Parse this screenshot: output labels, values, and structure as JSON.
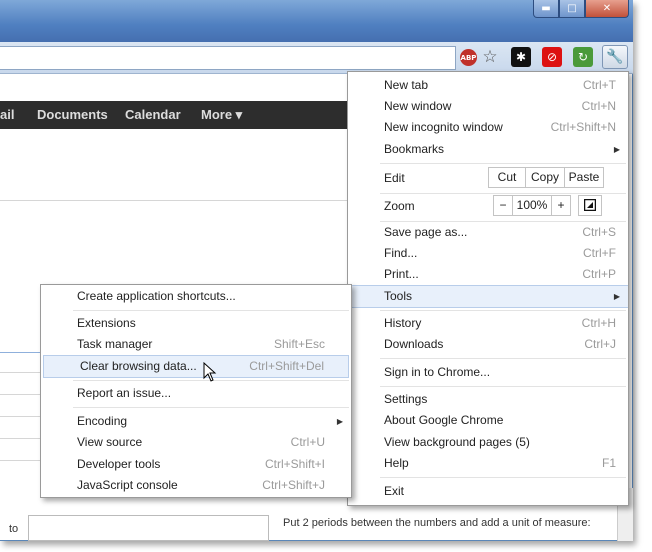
{
  "window": {
    "minimize_label": "▬",
    "maximize_label": "□",
    "close_label": "✕"
  },
  "toolbar": {
    "abp_label": "ABP"
  },
  "gbar": {
    "items": [
      "ail",
      "Documents",
      "Calendar",
      "More ▾"
    ]
  },
  "page": {
    "to_label": "to",
    "hint_line": "Put 2 periods between the numbers and add a unit of measure:"
  },
  "main_menu": {
    "new_tab": {
      "label": "New tab",
      "shortcut": "Ctrl+T"
    },
    "new_window": {
      "label": "New window",
      "shortcut": "Ctrl+N"
    },
    "new_incognito": {
      "label": "New incognito window",
      "shortcut": "Ctrl+Shift+N"
    },
    "bookmarks": {
      "label": "Bookmarks"
    },
    "edit": {
      "label": "Edit",
      "cut": "Cut",
      "copy": "Copy",
      "paste": "Paste"
    },
    "zoom": {
      "label": "Zoom",
      "minus": "−",
      "value": "100%",
      "plus": "+"
    },
    "save_page": {
      "label": "Save page as...",
      "shortcut": "Ctrl+S"
    },
    "find": {
      "label": "Find...",
      "shortcut": "Ctrl+F"
    },
    "print": {
      "label": "Print...",
      "shortcut": "Ctrl+P"
    },
    "tools": {
      "label": "Tools"
    },
    "history": {
      "label": "History",
      "shortcut": "Ctrl+H"
    },
    "downloads": {
      "label": "Downloads",
      "shortcut": "Ctrl+J"
    },
    "sign_in": {
      "label": "Sign in to Chrome..."
    },
    "settings": {
      "label": "Settings"
    },
    "about": {
      "label": "About Google Chrome"
    },
    "background_pages": {
      "label": "View background pages (5)"
    },
    "help": {
      "label": "Help",
      "shortcut": "F1"
    },
    "exit": {
      "label": "Exit"
    }
  },
  "tools_menu": {
    "create_shortcuts": {
      "label": "Create application shortcuts..."
    },
    "extensions": {
      "label": "Extensions"
    },
    "task_manager": {
      "label": "Task manager",
      "shortcut": "Shift+Esc"
    },
    "clear_browsing": {
      "label": "Clear browsing data...",
      "shortcut": "Ctrl+Shift+Del"
    },
    "report_issue": {
      "label": "Report an issue..."
    },
    "encoding": {
      "label": "Encoding"
    },
    "view_source": {
      "label": "View source",
      "shortcut": "Ctrl+U"
    },
    "developer_tools": {
      "label": "Developer tools",
      "shortcut": "Ctrl+Shift+I"
    },
    "js_console": {
      "label": "JavaScript console",
      "shortcut": "Ctrl+Shift+J"
    }
  },
  "icons": {
    "star": "☆",
    "wrench": "🔧",
    "submenu_arrow": "▶"
  },
  "colors": {
    "titlebar": "#5b87c4",
    "highlight": "#e8f0fb",
    "gbar": "#2d2d2d"
  }
}
